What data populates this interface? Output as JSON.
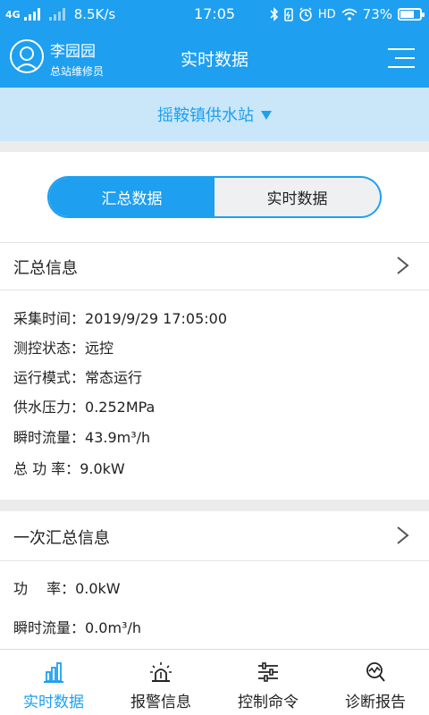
{
  "status_bar": {
    "network": "4G",
    "speed": "8.5K/s",
    "time": "17:05",
    "hd": "HD",
    "battery": "73%",
    "battery_level": 0.73
  },
  "header": {
    "user_name": "李园园",
    "user_role": "总站维修员",
    "title": "实时数据",
    "menu_icon": "menu-lines-icon"
  },
  "station": {
    "name": "摇鞍镇供水站",
    "dropdown_icon": "caret-down-icon"
  },
  "segment": {
    "tabs": [
      "汇总数据",
      "实时数据"
    ],
    "active_index": 0
  },
  "summary": {
    "title": "汇总信息",
    "rows": [
      {
        "label": "采集时间：",
        "value": "2019/9/29 17:05:00"
      },
      {
        "label": "测控状态：",
        "value": "远控"
      },
      {
        "label": "运行模式：",
        "value": "常态运行"
      },
      {
        "label": "供水压力：",
        "value": "0.252MPa"
      },
      {
        "label": "瞬时流量：",
        "value": "43.9m³/h"
      },
      {
        "label": "总 功 率：",
        "value": "9.0kW"
      }
    ]
  },
  "primary": {
    "title": "一次汇总信息",
    "rows": [
      {
        "label": "功　 率：",
        "value": "0.0kW"
      },
      {
        "label": "瞬时流量：",
        "value": "0.0m³/h"
      }
    ]
  },
  "bottom_nav": {
    "items": [
      {
        "label": "实时数据",
        "icon": "bar-chart-icon"
      },
      {
        "label": "报警信息",
        "icon": "alarm-light-icon"
      },
      {
        "label": "控制命令",
        "icon": "sliders-icon"
      },
      {
        "label": "诊断报告",
        "icon": "diagnosis-chart-icon"
      }
    ],
    "active_index": 0
  },
  "colors": {
    "primary": "#1e9ff0",
    "station_bg": "#c9e7f9",
    "separator": "#ececec"
  }
}
